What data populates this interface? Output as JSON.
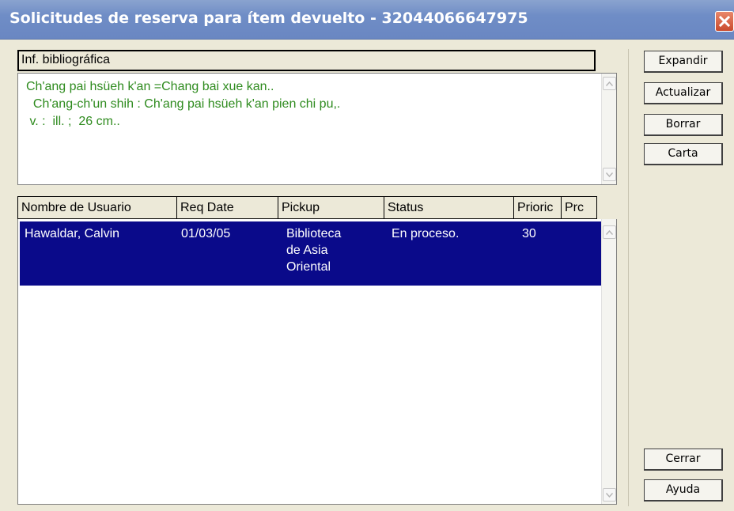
{
  "window": {
    "title": "Solicitudes de reserva para ítem devuelto - 32044066647975"
  },
  "biblio": {
    "header": "Inf. bibliográfica",
    "lines": [
      "Ch'ang pai hsüeh k'an =Chang bai xue kan..",
      "  Ch'ang-ch'un shih : Ch'ang pai hsüeh k'an pien chi pu,.",
      " v. :  ill. ;  26 cm.."
    ]
  },
  "requests": {
    "columns": [
      "Nombre de Usuario",
      "Req Date",
      "Pickup",
      "Status",
      "Prioric",
      "Prc"
    ],
    "rows": [
      {
        "user": "Hawaldar, Calvin",
        "req_date": "01/03/05",
        "pickup": [
          "Biblioteca",
          "de Asia",
          "Oriental"
        ],
        "status": "En proceso.",
        "priority": "30"
      }
    ]
  },
  "buttons": {
    "expand": "Expandir",
    "refresh": "Actualizar",
    "delete": "Borrar",
    "letter": "Carta",
    "close": "Cerrar",
    "help": "Ayuda"
  },
  "colors": {
    "titlebar": "#6f8dc6",
    "biblio_text": "#2e8b1e",
    "selection": "#0a0a8a"
  }
}
